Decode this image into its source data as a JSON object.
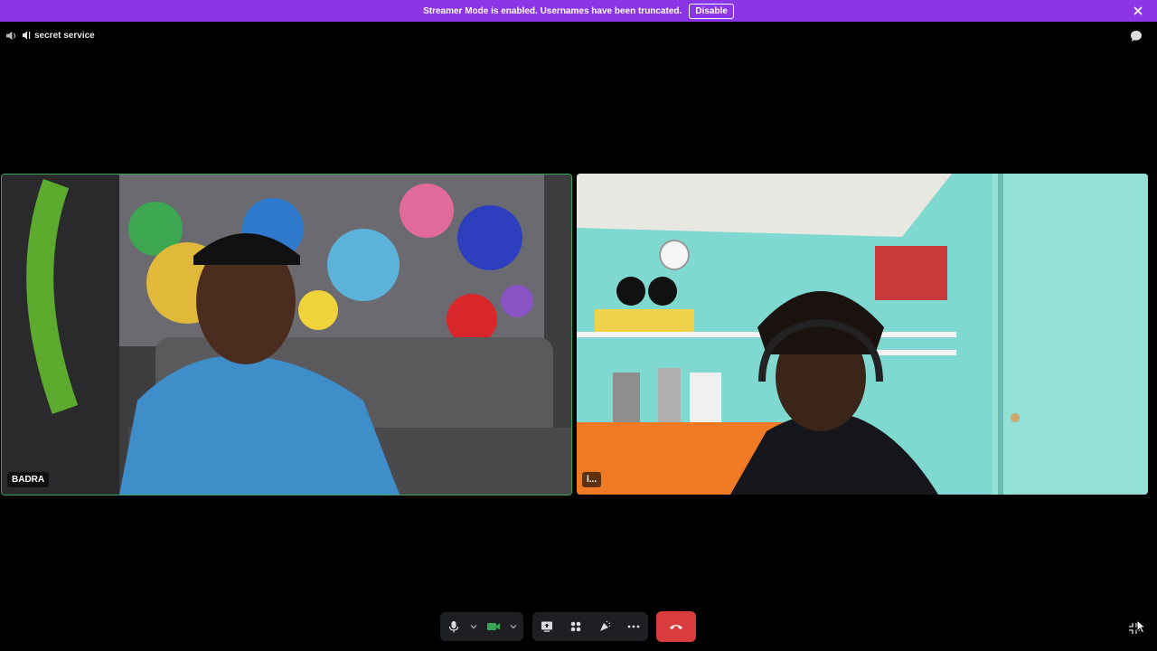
{
  "banner": {
    "message": "Streamer Mode is enabled. Usernames have been truncated.",
    "disable_label": "Disable"
  },
  "header": {
    "channel_name": "secret service"
  },
  "tiles": [
    {
      "name": "BADRA",
      "speaking": true
    },
    {
      "name": "l..."
    }
  ],
  "controls": {
    "icons": [
      "microphone-icon",
      "camera-icon",
      "screen-share-icon",
      "activities-icon",
      "soundboard-icon",
      "more-icon",
      "leave-call-icon"
    ]
  },
  "colors": {
    "banner": "#8c35e6",
    "speaking_border": "#3ba55c",
    "camera_on": "#3ba55c",
    "leave": "#d83c3e"
  }
}
